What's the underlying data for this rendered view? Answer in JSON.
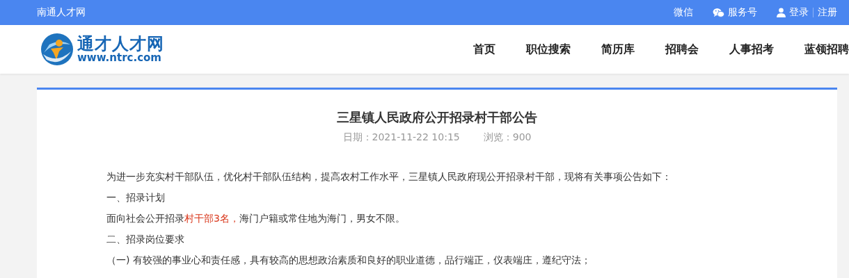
{
  "top_bar": {
    "site_name": "南通人才网",
    "links": [
      "微信",
      "服务号",
      "登录",
      "注册"
    ]
  },
  "header": {
    "logo": {
      "title": "通才人才网",
      "url": "www.ntrc.com"
    },
    "nav": [
      "首页",
      "职位搜索",
      "简历库",
      "招聘会",
      "人事招考",
      "蓝领招聘"
    ]
  },
  "article": {
    "title": "三星镇人民政府公开招录村干部公告",
    "date": "日期：2021-11-22 10:15",
    "views": "浏览：900",
    "paragraphs": [
      [
        {
          "text": "为进一步充实村干部队伍，优化村干部队伍结构，提高农村工作水平，三星镇人民政府现公开招录村干部，现将有关事项公告如下：",
          "highlight": false
        }
      ],
      [
        {
          "text": "一、招录计划",
          "highlight": false
        }
      ],
      [
        {
          "text": "面向社会公开招录",
          "highlight": false
        },
        {
          "text": "村干部3名，",
          "highlight": true
        },
        {
          "text": "海门户籍或常住地为海门，男女不限。",
          "highlight": false
        }
      ],
      [
        {
          "text": "二、招录岗位要求",
          "highlight": false
        }
      ],
      [
        {
          "text": "（一) 有较强的事业心和责任感，具有较高的思想政治素质和良好的职业道德，品行端正，仪表端庄，遵纪守法；",
          "highlight": false
        }
      ]
    ]
  }
}
